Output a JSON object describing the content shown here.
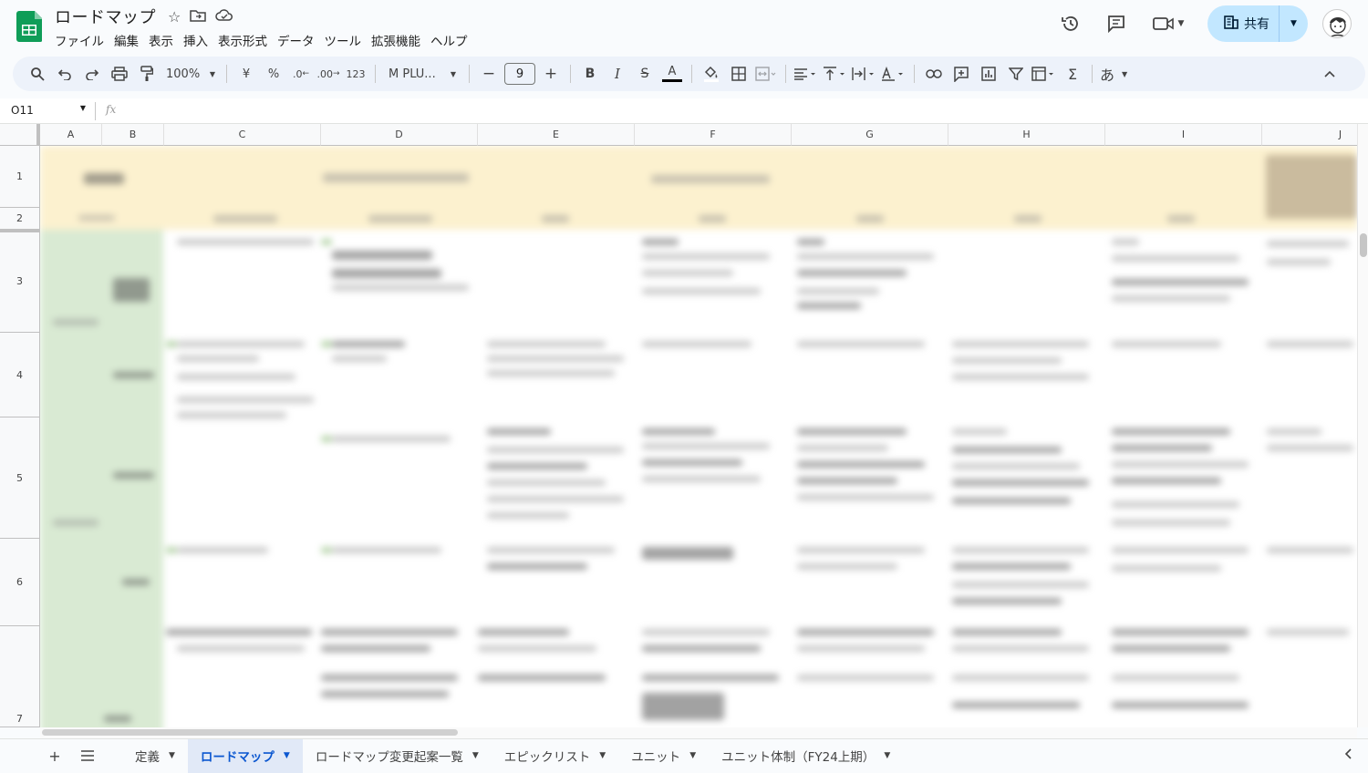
{
  "doc": {
    "title": "ロードマップ",
    "menu": [
      "ファイル",
      "編集",
      "表示",
      "挿入",
      "表示形式",
      "データ",
      "ツール",
      "拡張機能",
      "ヘルプ"
    ]
  },
  "header_right": {
    "share_label": "共有"
  },
  "toolbar": {
    "zoom": "100%",
    "currency": "¥",
    "percent": "%",
    "decimal_decrease": ".0",
    "decimal_increase": ".00",
    "number_format": "123",
    "font": "M PLU...",
    "font_size": "9",
    "bold": "B",
    "italic": "I",
    "text_color": "A",
    "sigma": "Σ",
    "input_tool": "あ"
  },
  "formula_bar": {
    "cell_ref": "O11",
    "fx": "fx"
  },
  "grid": {
    "columns": [
      "A",
      "B",
      "C",
      "D",
      "E",
      "F",
      "G",
      "H",
      "I",
      "J"
    ],
    "rows": [
      "1",
      "2",
      "3",
      "4",
      "5",
      "6",
      "7"
    ]
  },
  "sheets": {
    "tabs": [
      {
        "label": "定義",
        "active": false
      },
      {
        "label": "ロードマップ",
        "active": true
      },
      {
        "label": "ロードマップ変更起案一覧",
        "active": false
      },
      {
        "label": "エピックリスト",
        "active": false
      },
      {
        "label": "ユニット",
        "active": false
      },
      {
        "label": "ユニット体制（FY24上期）",
        "active": false
      }
    ]
  },
  "colors": {
    "header_band": "#fcf1cf",
    "first_columns": "#d9ead3",
    "share_button": "#c2e7ff",
    "active_tab_text": "#0b57d0"
  }
}
